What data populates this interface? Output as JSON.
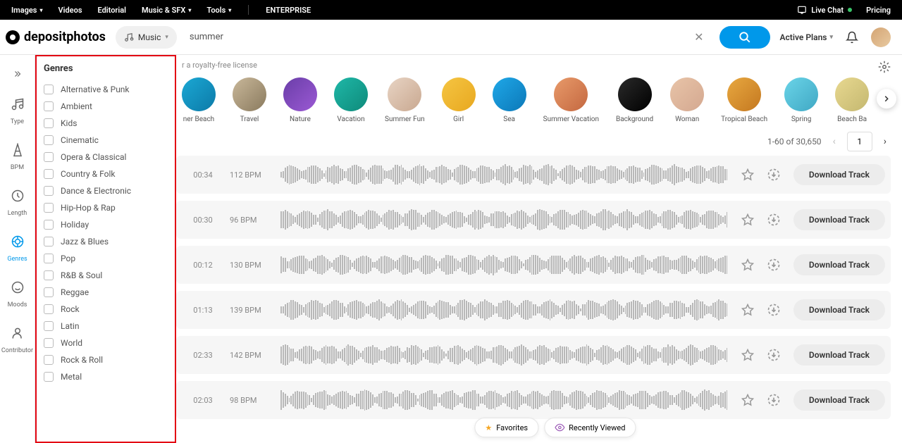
{
  "topbar": {
    "items": [
      "Images",
      "Videos",
      "Editorial",
      "Music & SFX",
      "Tools"
    ],
    "enterprise": "ENTERPRISE",
    "live_chat": "Live Chat",
    "pricing": "Pricing"
  },
  "header": {
    "logo": "depositphotos",
    "music_label": "Music",
    "search_value": "summer",
    "active_plans": "Active Plans"
  },
  "sidebar": {
    "items": [
      {
        "icon": "type",
        "label": "Type"
      },
      {
        "icon": "bpm",
        "label": "BPM"
      },
      {
        "icon": "length",
        "label": "Length"
      },
      {
        "icon": "genres",
        "label": "Genres"
      },
      {
        "icon": "moods",
        "label": "Moods"
      },
      {
        "icon": "contributor",
        "label": "Contributor"
      }
    ]
  },
  "genres": {
    "title": "Genres",
    "items": [
      "Alternative & Punk",
      "Ambient",
      "Kids",
      "Cinematic",
      "Opera & Classical",
      "Country & Folk",
      "Dance & Electronic",
      "Hip-Hop & Rap",
      "Holiday",
      "Jazz & Blues",
      "Pop",
      "R&B & Soul",
      "Reggae",
      "Rock",
      "Latin",
      "World",
      "Rock & Roll",
      "Metal"
    ]
  },
  "content": {
    "license_text": "r a royalty-free license",
    "categories": [
      {
        "label": "ner Beach",
        "bg": "linear-gradient(135deg,#1ba8d4,#0c7aa8)"
      },
      {
        "label": "Travel",
        "bg": "linear-gradient(135deg,#c9b89a,#8a7a5e)"
      },
      {
        "label": "Nature",
        "bg": "linear-gradient(135deg,#6a3ea8,#9b59d4)"
      },
      {
        "label": "Vacation",
        "bg": "linear-gradient(135deg,#1fb8a8,#0e8a7a)"
      },
      {
        "label": "Summer Fun",
        "bg": "linear-gradient(135deg,#e8d4c4,#c9a890)"
      },
      {
        "label": "Girl",
        "bg": "linear-gradient(135deg,#f5c542,#e8a820)"
      },
      {
        "label": "Sea",
        "bg": "linear-gradient(135deg,#1fa8e8,#0c78b8)"
      },
      {
        "label": "Summer Vacation",
        "bg": "linear-gradient(135deg,#e89a6a,#c46840)"
      },
      {
        "label": "Background",
        "bg": "linear-gradient(135deg,#2a2a2a,#000)"
      },
      {
        "label": "Woman",
        "bg": "linear-gradient(135deg,#e8c4a8,#d4a890)"
      },
      {
        "label": "Tropical Beach",
        "bg": "linear-gradient(135deg,#e8a840,#c47820)"
      },
      {
        "label": "Spring",
        "bg": "linear-gradient(135deg,#6ad4e8,#40a8c4)"
      },
      {
        "label": "Beach Ba",
        "bg": "linear-gradient(135deg,#e8d890,#c4b870)"
      }
    ],
    "pagination": {
      "info": "1-60 of 30,650",
      "current": "1"
    },
    "tracks": [
      {
        "time": "00:34",
        "bpm": "112 BPM",
        "download": "Download Track"
      },
      {
        "time": "00:30",
        "bpm": "96 BPM",
        "download": "Download Track"
      },
      {
        "time": "00:12",
        "bpm": "130 BPM",
        "download": "Download Track"
      },
      {
        "time": "01:13",
        "bpm": "139 BPM",
        "download": "Download Track"
      },
      {
        "time": "02:33",
        "bpm": "142 BPM",
        "download": "Download Track"
      },
      {
        "time": "02:03",
        "bpm": "98 BPM",
        "download": "Download Track"
      }
    ]
  },
  "bottom": {
    "favorites": "Favorites",
    "recent": "Recently Viewed"
  }
}
